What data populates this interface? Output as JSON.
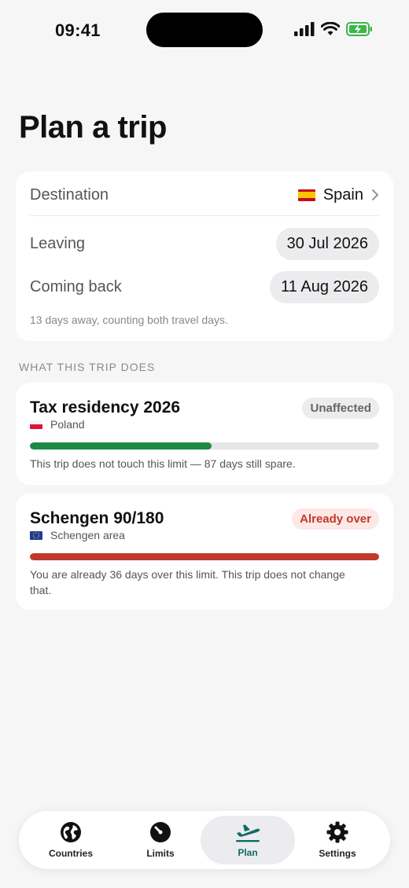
{
  "status_bar": {
    "time": "09:41"
  },
  "title": "Plan a trip",
  "trip": {
    "destination_label": "Destination",
    "destination_value": "Spain",
    "leaving_label": "Leaving",
    "leaving_value": "30 Jul 2026",
    "back_label": "Coming back",
    "back_value": "11 Aug 2026",
    "hint": "13 days away, counting both travel days."
  },
  "section_header": "WHAT THIS TRIP DOES",
  "limits": [
    {
      "title": "Tax residency 2026",
      "country": "Poland",
      "badge": "Unaffected",
      "progress": 0.52,
      "note": "This trip does not touch this limit — 87 days still spare."
    },
    {
      "title": "Schengen 90/180",
      "country": "Schengen area",
      "badge": "Already over",
      "progress": 1.0,
      "note": "You are already 36 days over this limit. This trip does not change that."
    }
  ],
  "tabs": [
    {
      "label": "Countries",
      "icon": "globe-icon"
    },
    {
      "label": "Limits",
      "icon": "gauge-icon"
    },
    {
      "label": "Plan",
      "icon": "airplane-takeoff-icon"
    },
    {
      "label": "Settings",
      "icon": "gear-icon"
    }
  ],
  "colors": {
    "accent": "#0f6b6b",
    "ok_bar": "#1f8a45",
    "over_bar": "#c0392b",
    "over_badge_bg": "#fde8e6",
    "over_badge_text": "#c0392b",
    "neutral_badge_bg": "#ececee",
    "neutral_badge_text": "#666666"
  }
}
